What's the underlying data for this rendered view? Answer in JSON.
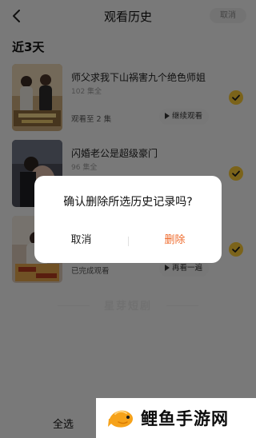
{
  "header": {
    "title": "观看历史",
    "cancel_label": "取消"
  },
  "section_label": "近3天",
  "items": [
    {
      "title": "师父求我下山祸害九个绝色师姐",
      "episodes": "102 集全",
      "progress": "观看至 2 集",
      "action": "继续观看"
    },
    {
      "title": "闪婚老公是超级豪门",
      "episodes": "96 集全",
      "progress": "",
      "action": ""
    },
    {
      "title": "",
      "episodes": "",
      "progress": "已完成观看",
      "action": "再看一遍"
    }
  ],
  "watermark": "星芽短剧",
  "dialog": {
    "message": "确认删除所选历史记录吗?",
    "cancel": "取消",
    "delete": "删除"
  },
  "footer": {
    "select_all": "全选"
  },
  "brand": {
    "text": "鲤鱼手游网"
  },
  "colors": {
    "accent": "#f6c634",
    "delete": "#ef6a2b"
  }
}
